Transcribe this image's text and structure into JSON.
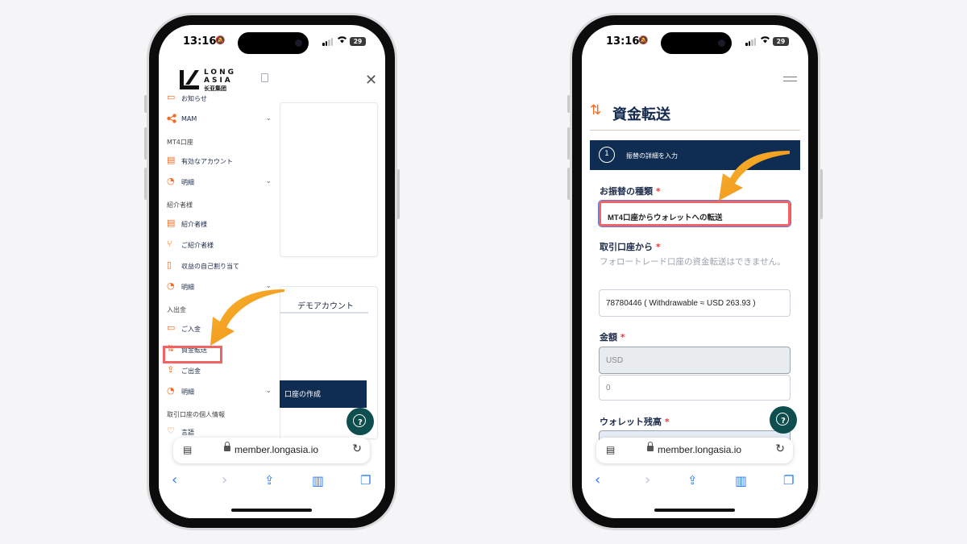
{
  "status_bar": {
    "time": "13:16",
    "battery": "29"
  },
  "browser": {
    "url": "member.longasia.io"
  },
  "left_phone": {
    "logo": {
      "line1": "LONG",
      "line2": "ASIA",
      "line3": "长亚集团"
    },
    "menu": {
      "top_partial": "お知らせ",
      "mam": "MAM",
      "section_mt4": "MT4口座",
      "active_accounts": "有効なアカウント",
      "details": "明細",
      "section_introducer": "紹介者様",
      "introducer": "紹介者様",
      "referrals": "ご紹介者様",
      "self_allocation": "収益の自己割り当て",
      "section_funding": "入出金",
      "deposit": "ご入金",
      "transfer": "資金転送",
      "withdrawal": "ご出金",
      "section_personal": "取引口座の個人情報",
      "bottom_partial": "言語"
    },
    "background": {
      "demo_tab": "デモアカウント",
      "create_button": "口座の作成"
    }
  },
  "right_phone": {
    "title": "資金転送",
    "step": {
      "number": "1",
      "label": "振替の詳細を入力"
    },
    "form": {
      "transfer_type_label": "お振替の種類",
      "transfer_type_value": "MT4口座からウォレットへの転送",
      "from_account_label": "取引口座から",
      "from_account_note": "フォロートレード口座の資金転送はできません。",
      "from_account_value": "78780446 ( Withdrawable ≈ USD 263.93 )",
      "amount_label": "金額",
      "amount_currency": "USD",
      "amount_value": "0",
      "wallet_label": "ウォレット残高",
      "required_mark": "*"
    }
  },
  "accent_colors": {
    "orange": "#f26b22",
    "highlight": "#f26363",
    "navy": "#0f2d52",
    "help": "#0e4e4f"
  }
}
